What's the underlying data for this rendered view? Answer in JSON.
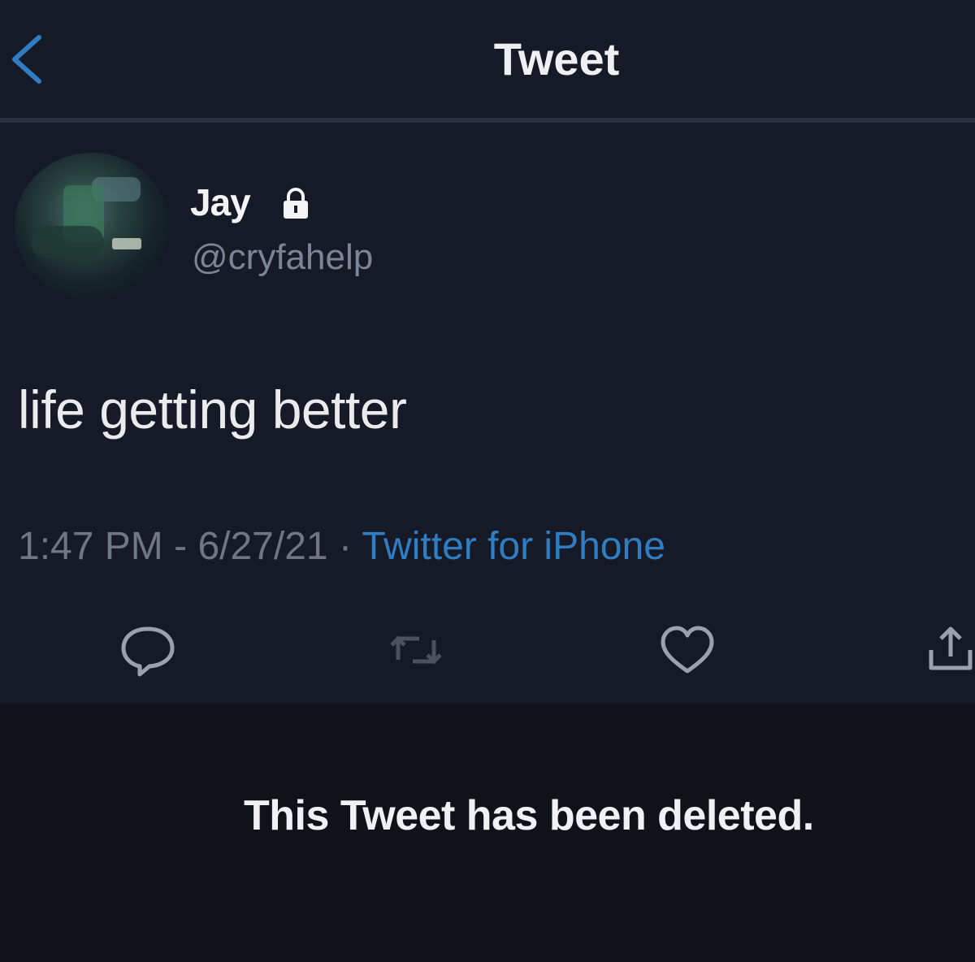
{
  "header": {
    "title": "Tweet",
    "back_icon": "chevron-left-icon"
  },
  "author": {
    "name": "Jay",
    "handle": "@cryfahelp",
    "protected_icon": "lock-icon"
  },
  "tweet": {
    "text": "life getting better",
    "time": "1:47 PM",
    "date": "6/27/21",
    "separator": "·",
    "source": "Twitter for iPhone"
  },
  "actions": {
    "icons": [
      "reply-icon",
      "retweet-icon",
      "like-icon",
      "share-icon"
    ]
  },
  "notice": {
    "text": "This Tweet has been deleted."
  },
  "colors": {
    "background": "#161a26",
    "link": "#2f7ec4",
    "muted": "#7c8595",
    "text": "#e9ebef"
  }
}
